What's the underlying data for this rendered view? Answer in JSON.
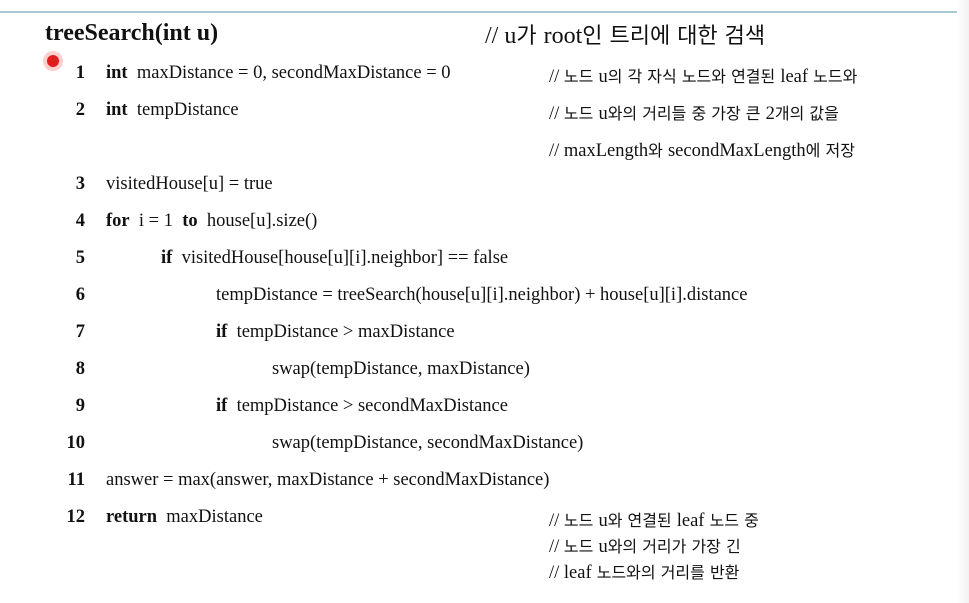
{
  "title": {
    "function": "treeSearch(int u)",
    "comment_prefix": "// ",
    "comment_var": "u",
    "comment_mid": "가 ",
    "comment_root": "root",
    "comment_suffix": "인 트리에 대한 검색"
  },
  "lines": [
    {
      "num": "1",
      "kw": "int",
      "code": "maxDistance  =  0, secondMaxDistance =  0"
    },
    {
      "num": "2",
      "kw": "int",
      "code": "tempDistance"
    },
    {
      "num": "3",
      "kw": "",
      "code": "visitedHouse[u]  =  true"
    },
    {
      "num": "4",
      "kw": "for",
      "code": "i = 1",
      "kw2": "to",
      "code2": "house[u].size()"
    },
    {
      "num": "5",
      "kw": "if",
      "code": "visitedHouse[house[u][i].neighbor]  ==  false"
    },
    {
      "num": "6",
      "kw": "",
      "code": "tempDistance  =  treeSearch(house[u][i].neighbor) + house[u][i].distance"
    },
    {
      "num": "7",
      "kw": "if",
      "code": "tempDistance > maxDistance"
    },
    {
      "num": "8",
      "kw": "",
      "code": "swap(tempDistance, maxDistance)"
    },
    {
      "num": "9",
      "kw": "if",
      "code": "tempDistance > secondMaxDistance"
    },
    {
      "num": "10",
      "kw": "",
      "code": "swap(tempDistance, secondMaxDistance)"
    },
    {
      "num": "11",
      "kw": "",
      "code": "answer = max(answer, maxDistance + secondMaxDistance)"
    },
    {
      "num": "12",
      "kw": "return",
      "code": "maxDistance"
    }
  ],
  "comments": [
    {
      "parts": [
        "// ",
        "노드 ",
        "u",
        "의 각 자식 노드와 연결된 ",
        "leaf",
        " 노드와"
      ]
    },
    {
      "parts": [
        "// ",
        "노드 ",
        "u",
        "와의 거리들 중 가장 큰 ",
        "2",
        "개의 값을"
      ]
    },
    {
      "parts": [
        "// ",
        "",
        "maxLength",
        "와 ",
        "secondMaxLength",
        "에 저장"
      ]
    },
    {
      "parts": [
        "// ",
        "노드 ",
        "u",
        "와 연결된 ",
        "leaf",
        " 노드 중"
      ]
    },
    {
      "parts": [
        "// ",
        "노드 ",
        "u",
        "와의 거리가 가장 긴",
        "",
        ""
      ]
    },
    {
      "parts": [
        "// ",
        "",
        "leaf",
        " 노드와의 거리를 반환",
        "",
        ""
      ]
    }
  ]
}
